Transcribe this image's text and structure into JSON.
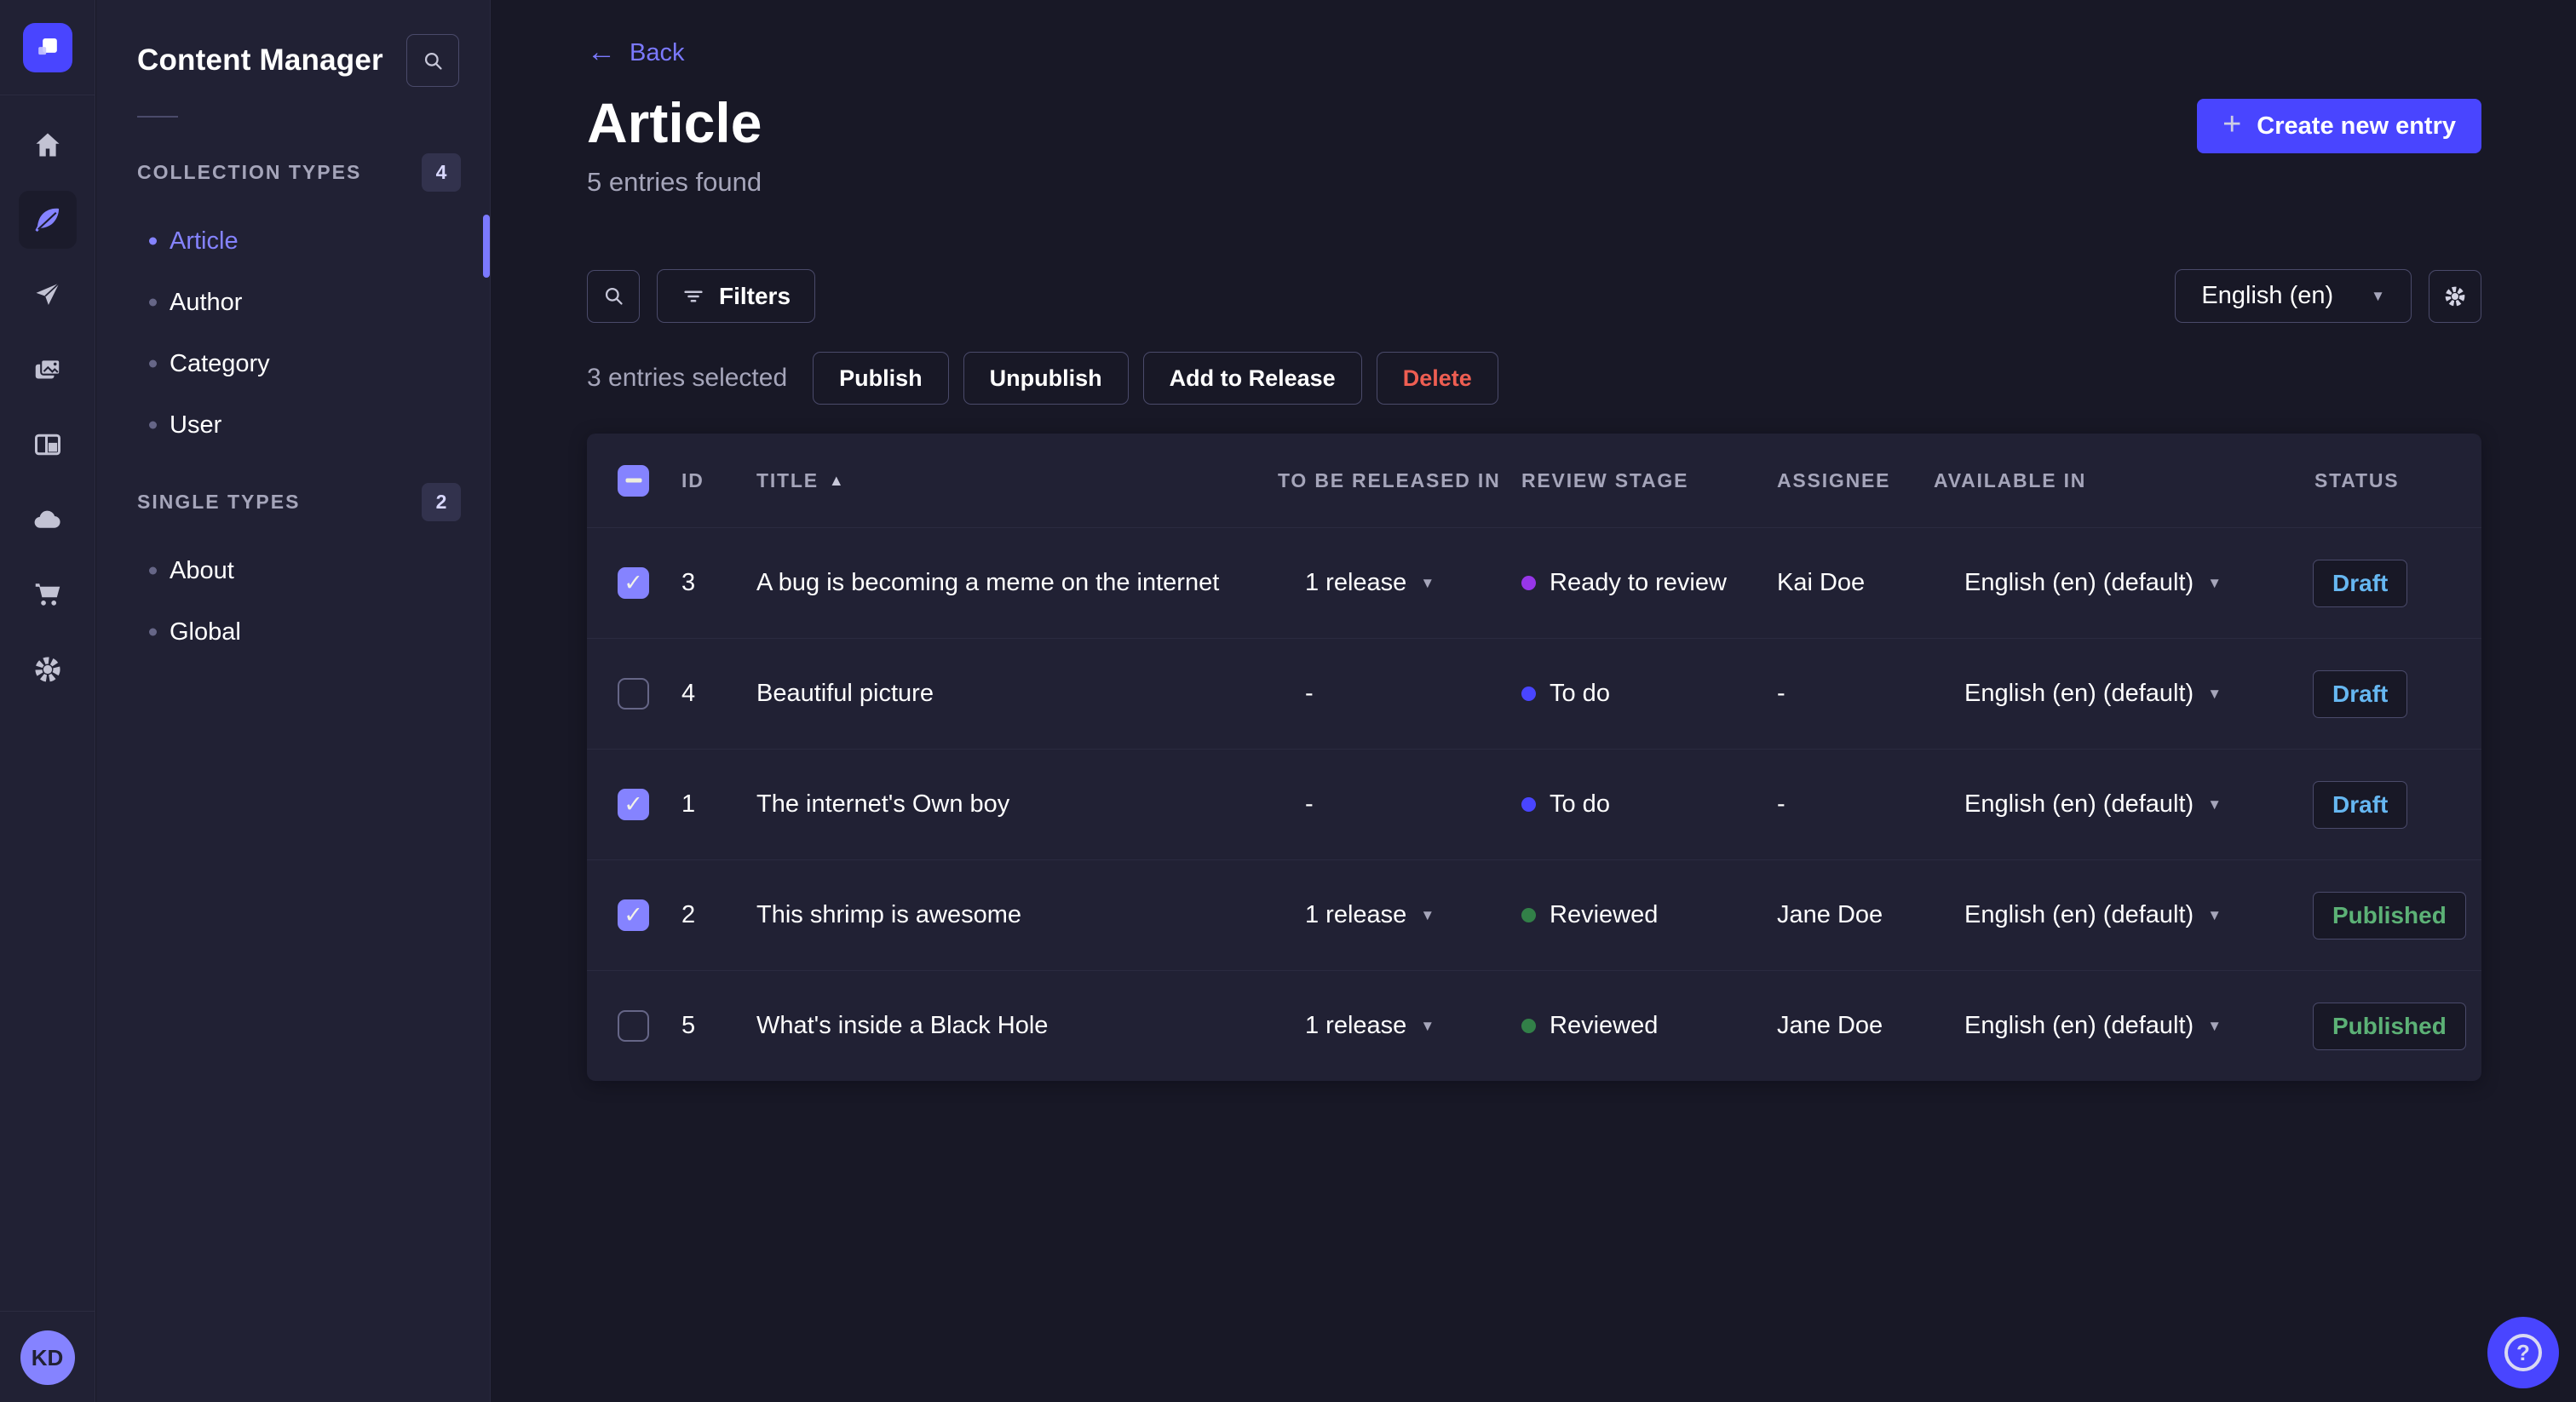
{
  "colors": {
    "accent": "#4945ff",
    "accent_light": "#8583ff",
    "danger": "#ee5e52",
    "success_text": "#5cb176",
    "draft_text": "#66b7f1",
    "page_bg": "#181826",
    "panel_bg": "#212134"
  },
  "iconbar": {
    "icons": [
      "home-icon",
      "feather-icon",
      "paper-plane-icon",
      "media-icon",
      "layout-icon",
      "cloud-icon",
      "cart-icon",
      "gear-icon"
    ],
    "active_icon": "feather-icon",
    "avatar_initials": "KD"
  },
  "subnav": {
    "title": "Content Manager",
    "search_icon": "search-icon",
    "sections": [
      {
        "label": "COLLECTION TYPES",
        "badge": "4",
        "items": [
          {
            "label": "Article",
            "active": true
          },
          {
            "label": "Author",
            "active": false
          },
          {
            "label": "Category",
            "active": false
          },
          {
            "label": "User",
            "active": false
          }
        ]
      },
      {
        "label": "SINGLE TYPES",
        "badge": "2",
        "items": [
          {
            "label": "About",
            "active": false
          },
          {
            "label": "Global",
            "active": false
          }
        ]
      }
    ]
  },
  "header": {
    "back_label": "Back",
    "back_arrow": "←",
    "title": "Article",
    "subtitle": "5 entries found",
    "create_button_label": "Create new entry",
    "create_button_plus": "+"
  },
  "toolbar": {
    "filters_label": "Filters",
    "locale_value": "English (en)"
  },
  "selection": {
    "text": "3 entries selected",
    "actions": [
      "Publish",
      "Unpublish",
      "Add to Release",
      "Delete"
    ]
  },
  "table": {
    "header_checkbox": "indeterminate",
    "columns": [
      "ID",
      "TITLE",
      "TO BE RELEASED IN",
      "REVIEW STAGE",
      "ASSIGNEE",
      "AVAILABLE IN",
      "STATUS"
    ],
    "sort": {
      "column": "TITLE",
      "direction": "asc",
      "arrow": "▲"
    },
    "caret_glyph": "▼",
    "rows": [
      {
        "checked": true,
        "id": "3",
        "title": "A bug is becoming a meme on the internet",
        "release": "1 release",
        "stage": "Ready to review",
        "stage_color": "#9736e8",
        "assignee": "Kai Doe",
        "locale": "English (en) (default)",
        "status": "Draft"
      },
      {
        "checked": false,
        "id": "4",
        "title": "Beautiful picture",
        "release": "-",
        "stage": "To do",
        "stage_color": "#4945ff",
        "assignee": "-",
        "locale": "English (en) (default)",
        "status": "Draft"
      },
      {
        "checked": true,
        "id": "1",
        "title": "The internet's Own boy",
        "release": "-",
        "stage": "To do",
        "stage_color": "#4945ff",
        "assignee": "-",
        "locale": "English (en) (default)",
        "status": "Draft"
      },
      {
        "checked": true,
        "id": "2",
        "title": "This shrimp is awesome",
        "release": "1 release",
        "stage": "Reviewed",
        "stage_color": "#328048",
        "assignee": "Jane Doe",
        "locale": "English (en) (default)",
        "status": "Published"
      },
      {
        "checked": false,
        "id": "5",
        "title": "What's inside a Black Hole",
        "release": "1 release",
        "stage": "Reviewed",
        "stage_color": "#328048",
        "assignee": "Jane Doe",
        "locale": "English (en) (default)",
        "status": "Published"
      }
    ]
  },
  "help": {
    "glyph": "?"
  }
}
